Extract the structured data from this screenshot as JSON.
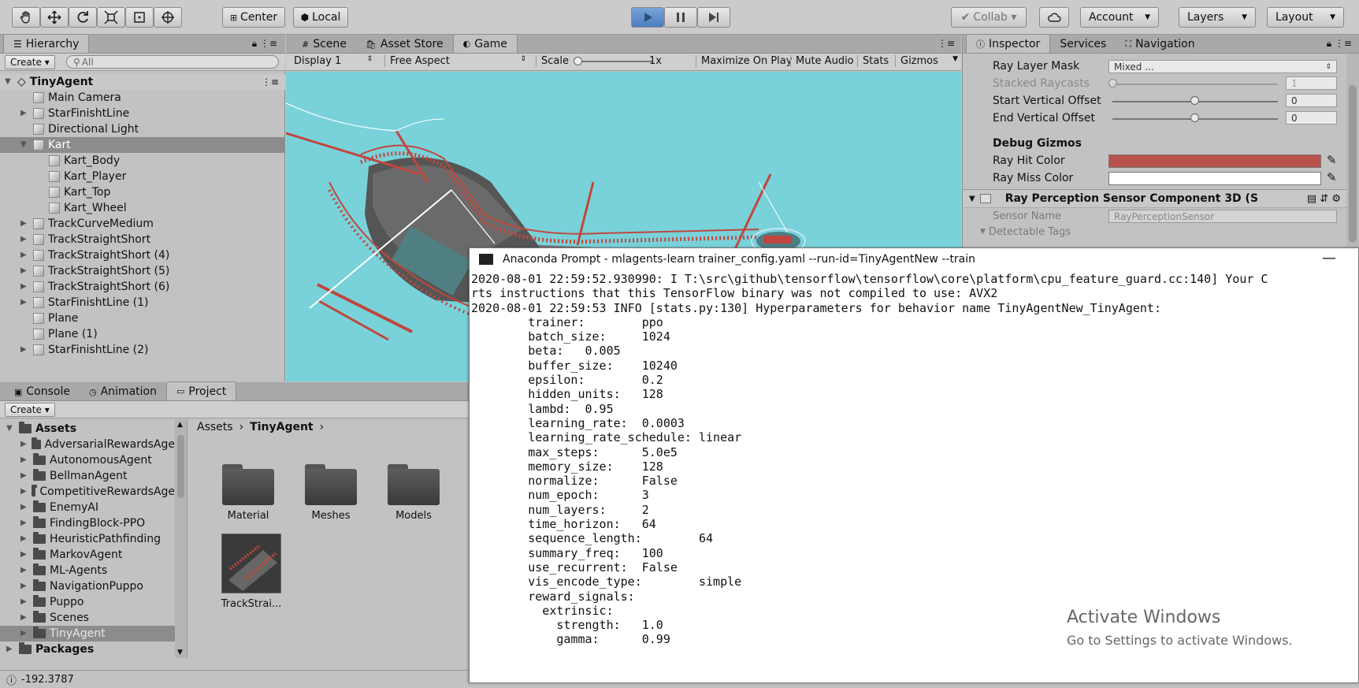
{
  "toolbar": {
    "center_label": "Center",
    "local_label": "Local",
    "collab_label": "Collab ▾",
    "account_label": "Account",
    "layers_label": "Layers",
    "layout_label": "Layout"
  },
  "hierarchy": {
    "tab_label": "Hierarchy",
    "create_label": "Create ▾",
    "search_placeholder": "All",
    "scene_name": "TinyAgent",
    "items": [
      {
        "label": "Main Camera",
        "indent": 1,
        "expandable": false
      },
      {
        "label": "StarFinishtLine",
        "indent": 1,
        "expandable": true
      },
      {
        "label": "Directional Light",
        "indent": 1,
        "expandable": false
      },
      {
        "label": "Kart",
        "indent": 1,
        "expandable": true,
        "selected": true
      },
      {
        "label": "Kart_Body",
        "indent": 2,
        "expandable": false
      },
      {
        "label": "Kart_Player",
        "indent": 2,
        "expandable": false
      },
      {
        "label": "Kart_Top",
        "indent": 2,
        "expandable": false
      },
      {
        "label": "Kart_Wheel",
        "indent": 2,
        "expandable": false
      },
      {
        "label": "TrackCurveMedium",
        "indent": 1,
        "expandable": true
      },
      {
        "label": "TrackStraightShort",
        "indent": 1,
        "expandable": true
      },
      {
        "label": "TrackStraightShort (4)",
        "indent": 1,
        "expandable": true
      },
      {
        "label": "TrackStraightShort (5)",
        "indent": 1,
        "expandable": true
      },
      {
        "label": "TrackStraightShort (6)",
        "indent": 1,
        "expandable": true
      },
      {
        "label": "StarFinishtLine (1)",
        "indent": 1,
        "expandable": true
      },
      {
        "label": "Plane",
        "indent": 1,
        "expandable": false
      },
      {
        "label": "Plane (1)",
        "indent": 1,
        "expandable": false
      },
      {
        "label": "StarFinishtLine (2)",
        "indent": 1,
        "expandable": true
      }
    ]
  },
  "game": {
    "tabs": [
      "Scene",
      "Asset Store",
      "Game"
    ],
    "display": "Display 1",
    "aspect": "Free Aspect",
    "scale_label": "Scale",
    "scale_value": "1x",
    "maximize": "Maximize On Play",
    "mute": "Mute Audio",
    "stats": "Stats",
    "gizmos": "Gizmos"
  },
  "inspector": {
    "tabs": [
      "Inspector",
      "Services",
      "Navigation"
    ],
    "ray_layer_mask_label": "Ray Layer Mask",
    "ray_layer_mask_value": "Mixed ...",
    "stacked_raycasts_label": "Stacked Raycasts",
    "stacked_raycasts_value": "1",
    "start_offset_label": "Start Vertical Offset",
    "start_offset_value": "0",
    "end_offset_label": "End Vertical Offset",
    "end_offset_value": "0",
    "debug_header": "Debug Gizmos",
    "hit_color_label": "Ray Hit Color",
    "miss_color_label": "Ray Miss Color",
    "hit_color": "#b8524a",
    "miss_color": "#ffffff",
    "component_title": "Ray Perception Sensor Component 3D (S",
    "sensor_name_label": "Sensor Name",
    "sensor_name_value": "RayPerceptionSensor",
    "detectable_tags_label": "Detectable Tags"
  },
  "bottom_tabs": [
    "Console",
    "Animation",
    "Project"
  ],
  "project": {
    "create_label": "Create ▾",
    "tree": [
      {
        "label": "Assets",
        "bold": true,
        "indent": 0
      },
      {
        "label": "AdversarialRewardsAge",
        "indent": 1
      },
      {
        "label": "AutonomousAgent",
        "indent": 1
      },
      {
        "label": "BellmanAgent",
        "indent": 1
      },
      {
        "label": "CompetitiveRewardsAge",
        "indent": 1
      },
      {
        "label": "EnemyAI",
        "indent": 1
      },
      {
        "label": "FindingBlock-PPO",
        "indent": 1
      },
      {
        "label": "HeuristicPathfinding",
        "indent": 1
      },
      {
        "label": "MarkovAgent",
        "indent": 1
      },
      {
        "label": "ML-Agents",
        "indent": 1
      },
      {
        "label": "NavigationPuppo",
        "indent": 1
      },
      {
        "label": "Puppo",
        "indent": 1
      },
      {
        "label": "Scenes",
        "indent": 1
      },
      {
        "label": "TinyAgent",
        "indent": 1,
        "selected": true
      },
      {
        "label": "Packages",
        "bold": true,
        "indent": 0
      }
    ],
    "breadcrumb_root": "Assets",
    "breadcrumb_current": "TinyAgent",
    "assets": [
      "Material",
      "Meshes",
      "Models",
      "TrackStrai..."
    ]
  },
  "status_bar": {
    "text": "-192.3787"
  },
  "console": {
    "title": "Anaconda Prompt - mlagents-learn  trainer_config.yaml --run-id=TinyAgentNew --train",
    "lines": [
      "2020-08-01 22:59:52.930990: I T:\\src\\github\\tensorflow\\tensorflow\\core\\platform\\cpu_feature_guard.cc:140] Your C",
      "rts instructions that this TensorFlow binary was not compiled to use: AVX2",
      "2020-08-01 22:59:53 INFO [stats.py:130] Hyperparameters for behavior name TinyAgentNew_TinyAgent:",
      "        trainer:        ppo",
      "        batch_size:     1024",
      "        beta:   0.005",
      "        buffer_size:    10240",
      "        epsilon:        0.2",
      "        hidden_units:   128",
      "        lambd:  0.95",
      "        learning_rate:  0.0003",
      "        learning_rate_schedule: linear",
      "        max_steps:      5.0e5",
      "        memory_size:    128",
      "        normalize:      False",
      "        num_epoch:      3",
      "        num_layers:     2",
      "        time_horizon:   64",
      "        sequence_length:        64",
      "        summary_freq:   100",
      "        use_recurrent:  False",
      "        vis_encode_type:        simple",
      "        reward_signals:",
      "          extrinsic:",
      "            strength:   1.0",
      "            gamma:      0.99"
    ]
  },
  "watermark": {
    "title": "Activate Windows",
    "subtitle": "Go to Settings to activate Windows."
  }
}
